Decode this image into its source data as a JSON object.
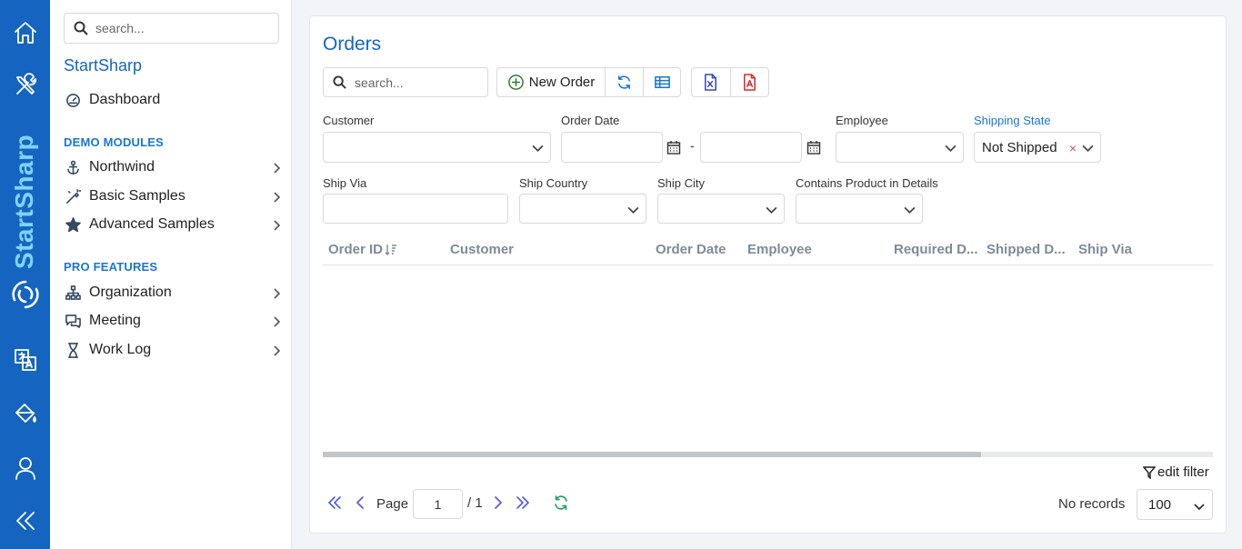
{
  "rail": {
    "brand_part1": "Start",
    "brand_part2": "Sharp",
    "icons": [
      "home-icon",
      "tools-icon",
      "translate-icon",
      "paint-bucket-icon",
      "user-icon",
      "collapse-icon"
    ]
  },
  "sidebar": {
    "search_placeholder": "search...",
    "title": "StartSharp",
    "dashboard": "Dashboard",
    "demo_section": "DEMO MODULES",
    "demo_items": [
      {
        "label": "Northwind",
        "icon": "anchor-icon"
      },
      {
        "label": "Basic Samples",
        "icon": "wand-icon"
      },
      {
        "label": "Advanced Samples",
        "icon": "star-icon"
      }
    ],
    "pro_section": "PRO FEATURES",
    "pro_items": [
      {
        "label": "Organization",
        "icon": "sitemap-icon"
      },
      {
        "label": "Meeting",
        "icon": "chat-icon"
      },
      {
        "label": "Work Log",
        "icon": "hourglass-icon"
      }
    ]
  },
  "main": {
    "title": "Orders",
    "search_placeholder": "search...",
    "new_order_label": "New Order",
    "filters": {
      "customer_label": "Customer",
      "order_date_label": "Order Date",
      "date_separator": "-",
      "employee_label": "Employee",
      "shipping_state_label": "Shipping State",
      "shipping_state_value": "Not Shipped",
      "clear_symbol": "×",
      "ship_via_label": "Ship Via",
      "ship_country_label": "Ship Country",
      "ship_city_label": "Ship City",
      "contains_product_label": "Contains Product in Details"
    },
    "columns": [
      "Order ID",
      "Customer",
      "Order Date",
      "Employee",
      "Required D...",
      "Shipped D...",
      "Ship Via"
    ],
    "edit_filter": "edit filter",
    "pager": {
      "page_label": "Page",
      "page_value": "1",
      "total_label": "/ 1",
      "records_label": "No records",
      "page_size": "100"
    }
  },
  "colors": {
    "rail": "#1565c0",
    "accent": "#1976d2",
    "pager_icon": "#5b5bd6",
    "refresh_icon": "#2e9e6b"
  }
}
